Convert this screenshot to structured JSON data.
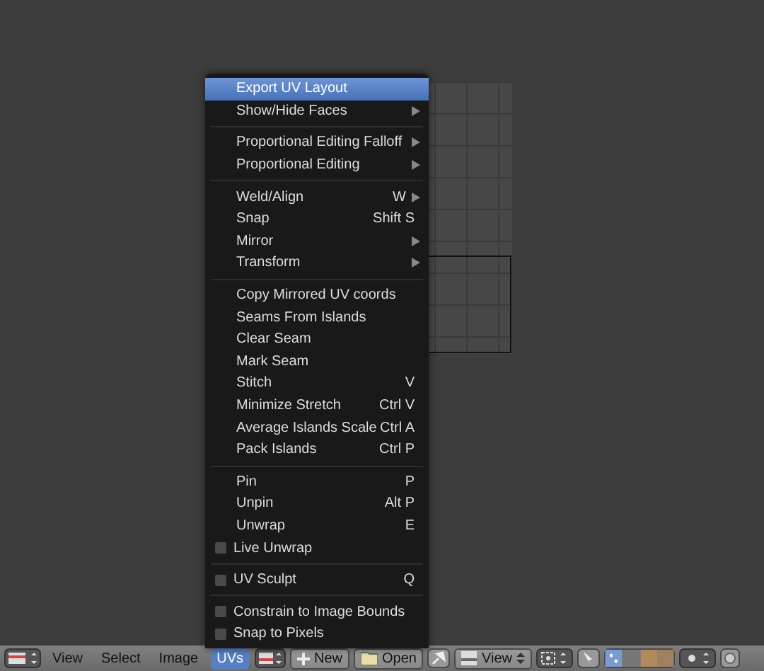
{
  "uv_menu": {
    "sections": [
      {
        "items": [
          {
            "kind": "item",
            "label": "Export UV Layout",
            "highlighted": true
          },
          {
            "kind": "submenu",
            "label": "Show/Hide Faces",
            "highlighted": false
          }
        ]
      },
      {
        "items": [
          {
            "kind": "submenu",
            "label": "Proportional Editing Falloff",
            "highlighted": false
          },
          {
            "kind": "submenu",
            "label": "Proportional Editing",
            "highlighted": false
          }
        ]
      },
      {
        "items": [
          {
            "kind": "submenu",
            "label": "Weld/Align",
            "shortcut": "W",
            "highlighted": false
          },
          {
            "kind": "item",
            "label": "Snap",
            "shortcut": "Shift S",
            "highlighted": false
          },
          {
            "kind": "submenu",
            "label": "Mirror",
            "highlighted": false
          },
          {
            "kind": "submenu",
            "label": "Transform",
            "highlighted": false
          }
        ]
      },
      {
        "items": [
          {
            "kind": "item",
            "label": "Copy Mirrored UV coords",
            "highlighted": false
          },
          {
            "kind": "item",
            "label": "Seams From Islands",
            "highlighted": false
          },
          {
            "kind": "item",
            "label": "Clear Seam",
            "highlighted": false
          },
          {
            "kind": "item",
            "label": "Mark Seam",
            "highlighted": false
          },
          {
            "kind": "item",
            "label": "Stitch",
            "shortcut": "V",
            "highlighted": false
          },
          {
            "kind": "item",
            "label": "Minimize Stretch",
            "shortcut": "Ctrl V",
            "highlighted": false
          },
          {
            "kind": "item",
            "label": "Average Islands Scale",
            "shortcut": "Ctrl A",
            "highlighted": false
          },
          {
            "kind": "item",
            "label": "Pack Islands",
            "shortcut": "Ctrl P",
            "highlighted": false
          }
        ]
      },
      {
        "items": [
          {
            "kind": "item",
            "label": "Pin",
            "shortcut": "P",
            "highlighted": false
          },
          {
            "kind": "item",
            "label": "Unpin",
            "shortcut": "Alt P",
            "highlighted": false
          },
          {
            "kind": "item",
            "label": "Unwrap",
            "shortcut": "E",
            "highlighted": false
          },
          {
            "kind": "checkbox",
            "label": "Live Unwrap",
            "checked": false,
            "highlighted": false
          }
        ]
      },
      {
        "items": [
          {
            "kind": "checkbox",
            "label": "UV Sculpt",
            "shortcut": "Q",
            "checked": false,
            "highlighted": false
          }
        ]
      },
      {
        "items": [
          {
            "kind": "checkbox",
            "label": "Constrain to Image Bounds",
            "checked": false,
            "highlighted": false
          },
          {
            "kind": "checkbox",
            "label": "Snap to Pixels",
            "checked": false,
            "highlighted": false
          }
        ]
      }
    ]
  },
  "header": {
    "menus": [
      {
        "label": "View",
        "selected": false
      },
      {
        "label": "Select",
        "selected": false
      },
      {
        "label": "Image",
        "selected": false
      },
      {
        "label": "UVs",
        "selected": true
      }
    ],
    "new_button": "New",
    "open_button": "Open",
    "view_dropdown": "View"
  }
}
